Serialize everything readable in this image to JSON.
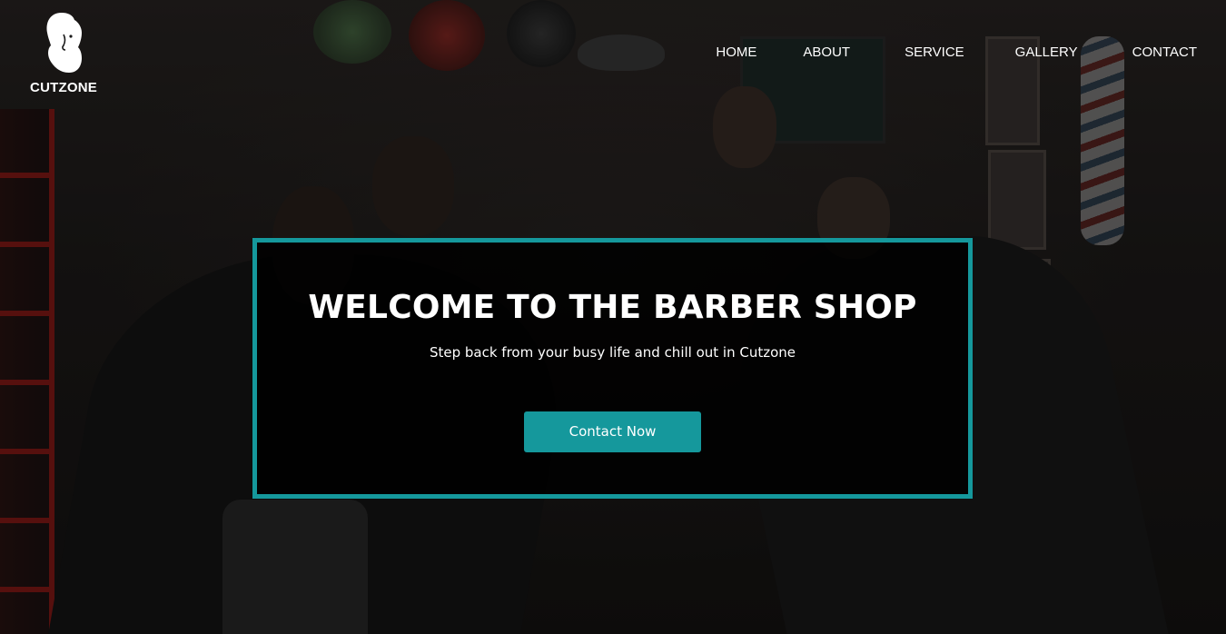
{
  "brand": {
    "name": "CUTZONE",
    "logo_icon": "bearded-man-icon"
  },
  "nav": {
    "items": [
      {
        "label": "HOME"
      },
      {
        "label": "ABOUT"
      },
      {
        "label": "SERVICE"
      },
      {
        "label": "GALLERY"
      },
      {
        "label": "CONTACT"
      }
    ]
  },
  "hero": {
    "title": "WELCOME TO THE BARBER SHOP",
    "subtitle": "Step back from your busy life and chill out in Cutzone",
    "cta_label": "Contact Now"
  },
  "colors": {
    "accent": "#15989c",
    "text": "#ffffff",
    "overlay": "#000000"
  }
}
